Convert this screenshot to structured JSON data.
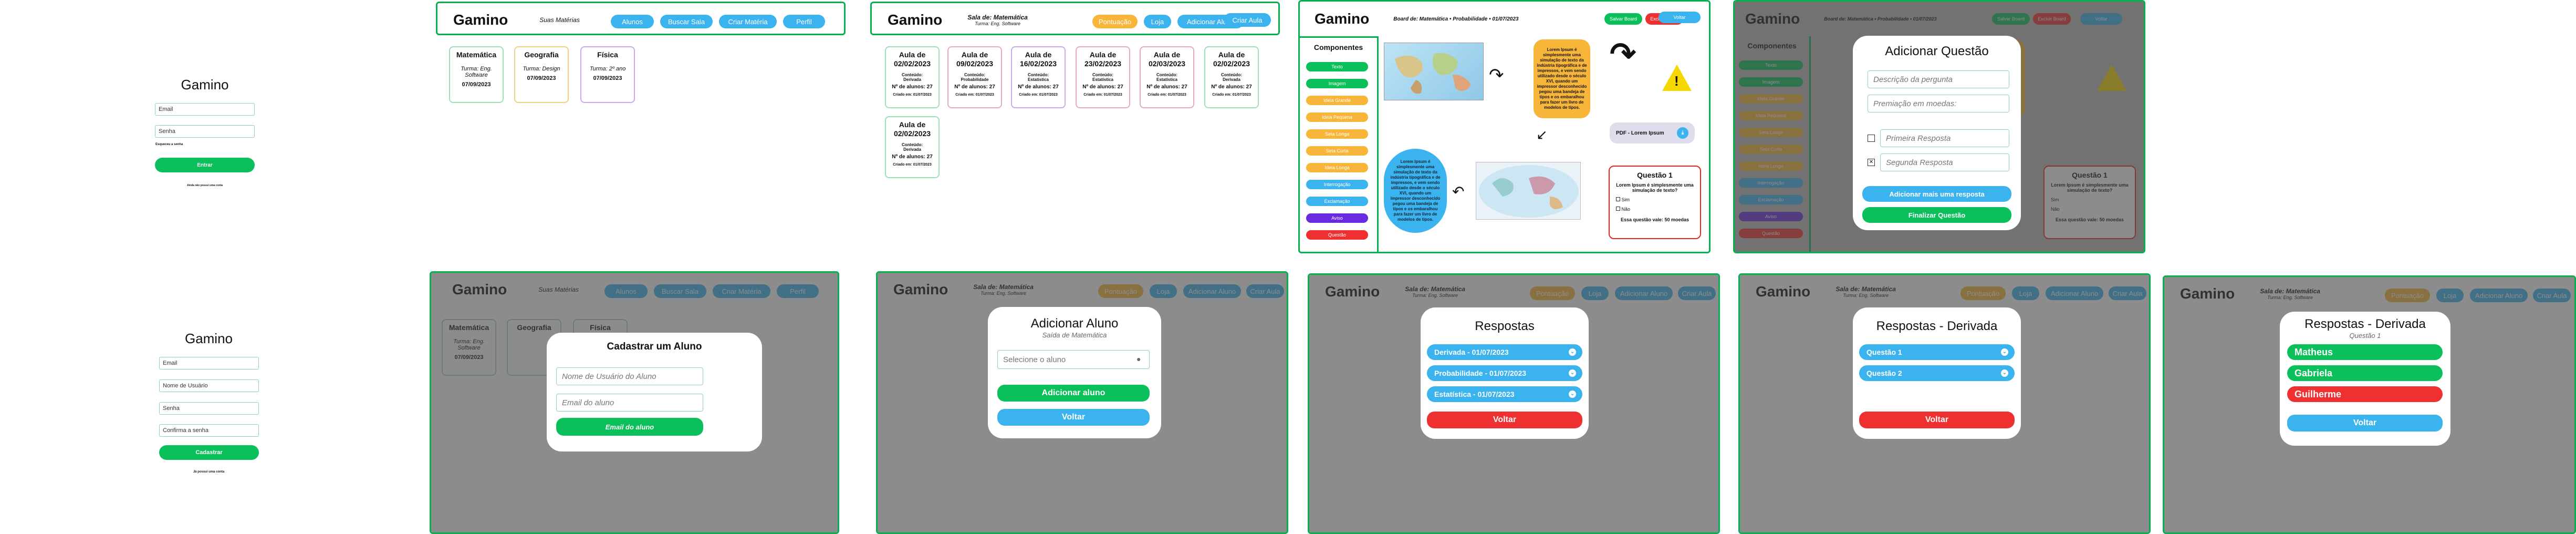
{
  "login": {
    "title": "Gamino",
    "email": "Email",
    "senha": "Senha",
    "forgot": "Esqueceu a senha",
    "submit": "Entrar",
    "register": "Ainda não possui uma conta"
  },
  "signup": {
    "title": "Gamino",
    "email": "Email",
    "usuario": "Nome de Usuário",
    "senha": "Senha",
    "confirma": "Confirma a senha",
    "submit": "Cadastrar",
    "login": "Já possui uma conta"
  },
  "teacher": {
    "logo": "Gamino",
    "subtitle": "Suas Matérias",
    "nav": [
      "Alunos",
      "Buscar Sala",
      "Criar Matéria",
      "Perfil"
    ],
    "subjects": [
      {
        "name": "Matemática",
        "turma": "Turma: Eng. Software",
        "date": "07/09/2023"
      },
      {
        "name": "Geografia",
        "turma": "Turma: Design",
        "date": "07/09/2023"
      },
      {
        "name": "Física",
        "turma": "Turma: 2º ano",
        "date": "07/09/2023"
      }
    ]
  },
  "room": {
    "logo": "Gamino",
    "title": "Sala de: Matemática",
    "subtitle": "Turma: Eng. Software",
    "nav": [
      "Pontuação",
      "Loja",
      "Adicionar Aluno",
      "Criar Aula"
    ],
    "lessons": [
      {
        "t": "Aula de",
        "d": "02/02/2023",
        "c": "Conteúdo: Derivada",
        "n": "Nº de alunos: 27",
        "cr": "Criado em: 01/07/2023"
      },
      {
        "t": "Aula de",
        "d": "09/02/2023",
        "c": "Conteúdo: Probabilidade",
        "n": "Nº de alunos: 27",
        "cr": "Criado em: 01/07/2023"
      },
      {
        "t": "Aula de",
        "d": "16/02/2023",
        "c": "Conteúdo: Estatística",
        "n": "Nº de alunos: 27",
        "cr": "Criado em: 01/07/2023"
      },
      {
        "t": "Aula de",
        "d": "23/02/2023",
        "c": "Conteúdo: Estatística",
        "n": "Nº de alunos: 27",
        "cr": "Criado em: 01/07/2023"
      },
      {
        "t": "Aula de",
        "d": "02/03/2023",
        "c": "Conteúdo: Estatística",
        "n": "Nº de alunos: 27",
        "cr": "Criado em: 01/07/2023"
      },
      {
        "t": "Aula de",
        "d": "02/02/2023",
        "c": "Conteúdo: Derivada",
        "n": "Nº de alunos: 27",
        "cr": "Criado em: 01/07/2023"
      },
      {
        "t": "Aula de",
        "d": "02/02/2023",
        "c": "Conteúdo: Derivada",
        "n": "Nº de alunos: 27",
        "cr": "Criado em: 01/07/2023"
      }
    ]
  },
  "board": {
    "logo": "Gamino",
    "title": "Board de: Matemática • Probabilidade • 01/07/2023",
    "buttons": [
      "Salvar Board",
      "Excluir Board",
      "Voltar"
    ],
    "comp_title": "Componentes",
    "components": [
      {
        "l": "Texto",
        "c": "g"
      },
      {
        "l": "Imagem",
        "c": "g"
      },
      {
        "l": "Ideia Grande",
        "c": "o"
      },
      {
        "l": "Ideia Pequena",
        "c": "o"
      },
      {
        "l": "Seta Longa",
        "c": "o"
      },
      {
        "l": "Seta Curta",
        "c": "o"
      },
      {
        "l": "Ideia Longa",
        "c": "o"
      },
      {
        "l": "Interrogação",
        "c": "b"
      },
      {
        "l": "Exclamação",
        "c": "b"
      },
      {
        "l": "Aviso",
        "c": "pu"
      },
      {
        "l": "Questão",
        "c": "r"
      }
    ],
    "note": "Lorem Ipsum é simplesmente uma simulação de texto da indústria tipográfica e de impressos, e vem sendo utilizado desde o século XVI, quando um impressor desconhecido pegou uma bandeja de tipos e os embaralhou para fazer um livro de modelos de tipos.",
    "note2": "Lorem Ipsum é simplesmente uma simulação de texto da indústria tipográfica e de impressos, e vem sendo utilizado desde o século XVI, quando um impressor desconhecido pegou uma bandeja de tipos e os embaralhou para fazer um livro de modelos de tipos.",
    "pdf": "PDF - Lorem Ipsum",
    "q": {
      "title": "Questão 1",
      "text": "Lorem Ipsum é simplesmente uma simulação de texto?",
      "opts": [
        "Sim",
        "Não"
      ],
      "worth": "Essa questão vale: 50 moedas"
    }
  },
  "addq": {
    "title": "Adicionar Questão",
    "desc": "Descrição da pergunta",
    "prem": "Premiação em moedas:",
    "a1": "Primeira Resposta",
    "a2": "Segunda Resposta",
    "more": "Adicionar mais uma resposta",
    "finish": "Finalizar Questão"
  },
  "cadaluno": {
    "title": "Cadastrar um Aluno",
    "user": "Nome de Usuário do Aluno",
    "email": "Email do aluno",
    "btn": "Email do aluno"
  },
  "addaluno": {
    "title": "Adicionar Aluno",
    "sub": "Saída de Matemática",
    "select": "Selecione o aluno",
    "add": "Adicionar aluno",
    "back": "Voltar"
  },
  "respostas": {
    "title": "Respostas",
    "items": [
      "Derivada - 01/07/2023",
      "Probabilidade - 01/07/2023",
      "Estatística - 01/07/2023"
    ],
    "back": "Voltar"
  },
  "respderiv": {
    "title": "Respostas - Derivada",
    "items": [
      "Questão 1",
      "Questão 2"
    ],
    "back": "Voltar"
  },
  "respq": {
    "title": "Respostas - Derivada",
    "sub": "Questão 1",
    "items": [
      {
        "n": "Matheus",
        "c": "g"
      },
      {
        "n": "Gabriela",
        "c": "g"
      },
      {
        "n": "Guilherme",
        "c": "r"
      }
    ],
    "back": "Voltar"
  }
}
